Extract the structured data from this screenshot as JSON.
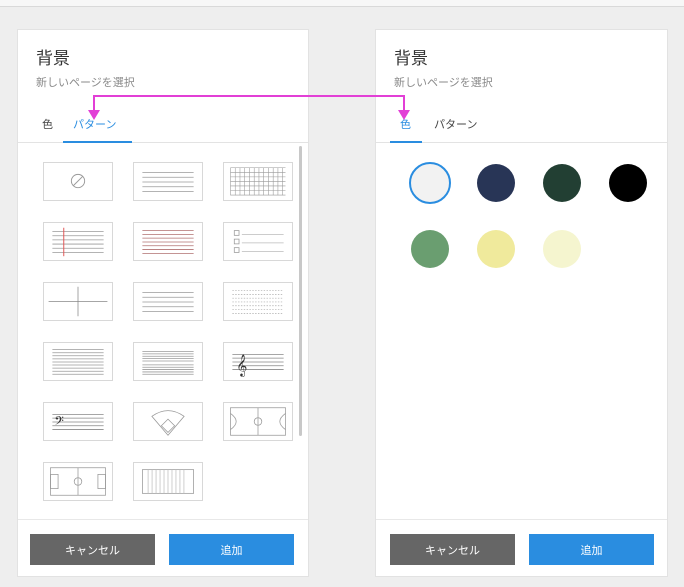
{
  "left_panel": {
    "title": "背景",
    "subtitle": "新しいページを選択",
    "tabs": [
      {
        "label": "色",
        "active": false
      },
      {
        "label": "パターン",
        "active": true
      }
    ],
    "patterns": [
      {
        "name": "none"
      },
      {
        "name": "ruled-wide"
      },
      {
        "name": "grid"
      },
      {
        "name": "ruled-margin"
      },
      {
        "name": "ruled-narrow"
      },
      {
        "name": "checklist"
      },
      {
        "name": "quadrant"
      },
      {
        "name": "ruled-medium"
      },
      {
        "name": "dotted-ruled"
      },
      {
        "name": "ruled-dense"
      },
      {
        "name": "staff-blank"
      },
      {
        "name": "treble-clef-staff"
      },
      {
        "name": "bass-clef-staff"
      },
      {
        "name": "baseball-field"
      },
      {
        "name": "basketball-court"
      },
      {
        "name": "soccer-field"
      },
      {
        "name": "football-field"
      }
    ],
    "buttons": {
      "cancel": "キャンセル",
      "add": "追加"
    }
  },
  "right_panel": {
    "title": "背景",
    "subtitle": "新しいページを選択",
    "tabs": [
      {
        "label": "色",
        "active": true
      },
      {
        "label": "パターン",
        "active": false
      }
    ],
    "colors": [
      {
        "name": "white",
        "hex": "#f2f2f2",
        "selected": true
      },
      {
        "name": "navy",
        "hex": "#283556",
        "selected": false
      },
      {
        "name": "dark-green",
        "hex": "#223f33",
        "selected": false
      },
      {
        "name": "black",
        "hex": "#000000",
        "selected": false
      },
      {
        "name": "green",
        "hex": "#6a9e70",
        "selected": false
      },
      {
        "name": "yellow",
        "hex": "#f0ea9c",
        "selected": false
      },
      {
        "name": "pale-yellow",
        "hex": "#f5f5cf",
        "selected": false
      }
    ],
    "buttons": {
      "cancel": "キャンセル",
      "add": "追加"
    }
  },
  "annotation_color": "#e23fd6",
  "accent": "#2a8de0"
}
